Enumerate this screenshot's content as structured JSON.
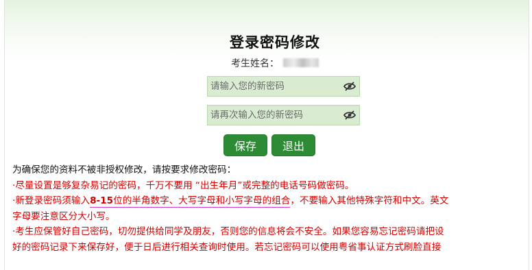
{
  "form": {
    "title": "登录密码修改",
    "name_label": "考生姓名：",
    "new_password_placeholder": "请输入您的新密码",
    "confirm_password_placeholder": "请再次输入您的新密码",
    "save_label": "保存",
    "exit_label": "退出"
  },
  "notes": {
    "heading": "为确保您的资料不被非授权修改，请按要求修改密码：",
    "note1": "·尽量设置是够复杂易记的密码，千万不要用 “出生年月”或完整的电话号码做密码。",
    "note2_prefix": "·新登录密码须输入",
    "note2_bold": "8-15",
    "note2_underlined": "位的半角数字、大写字母和小写字母的组合",
    "note2_suffix": "，不要输入其他特殊字符和中文。英文",
    "note2_line2": "字母要注意区分大小写。",
    "note3_line1": "·考生应保管好自己密码，切勿提供给同学及朋友，否则您的信息将会不安全。如果您容易忘记密码请把设",
    "note3_line2": "好的密码记录下来保存好，便于日后进行相关查询时使用。若忘记密码可以使用粤省事认证方式刷脸直接"
  },
  "colors": {
    "button_green": "#2e8b35",
    "input_green": "#d9ecd2",
    "warning_red": "#d40000",
    "underline_magenta": "#d236d2"
  },
  "icons": {
    "toggle_visibility": "eye-slash-icon"
  }
}
